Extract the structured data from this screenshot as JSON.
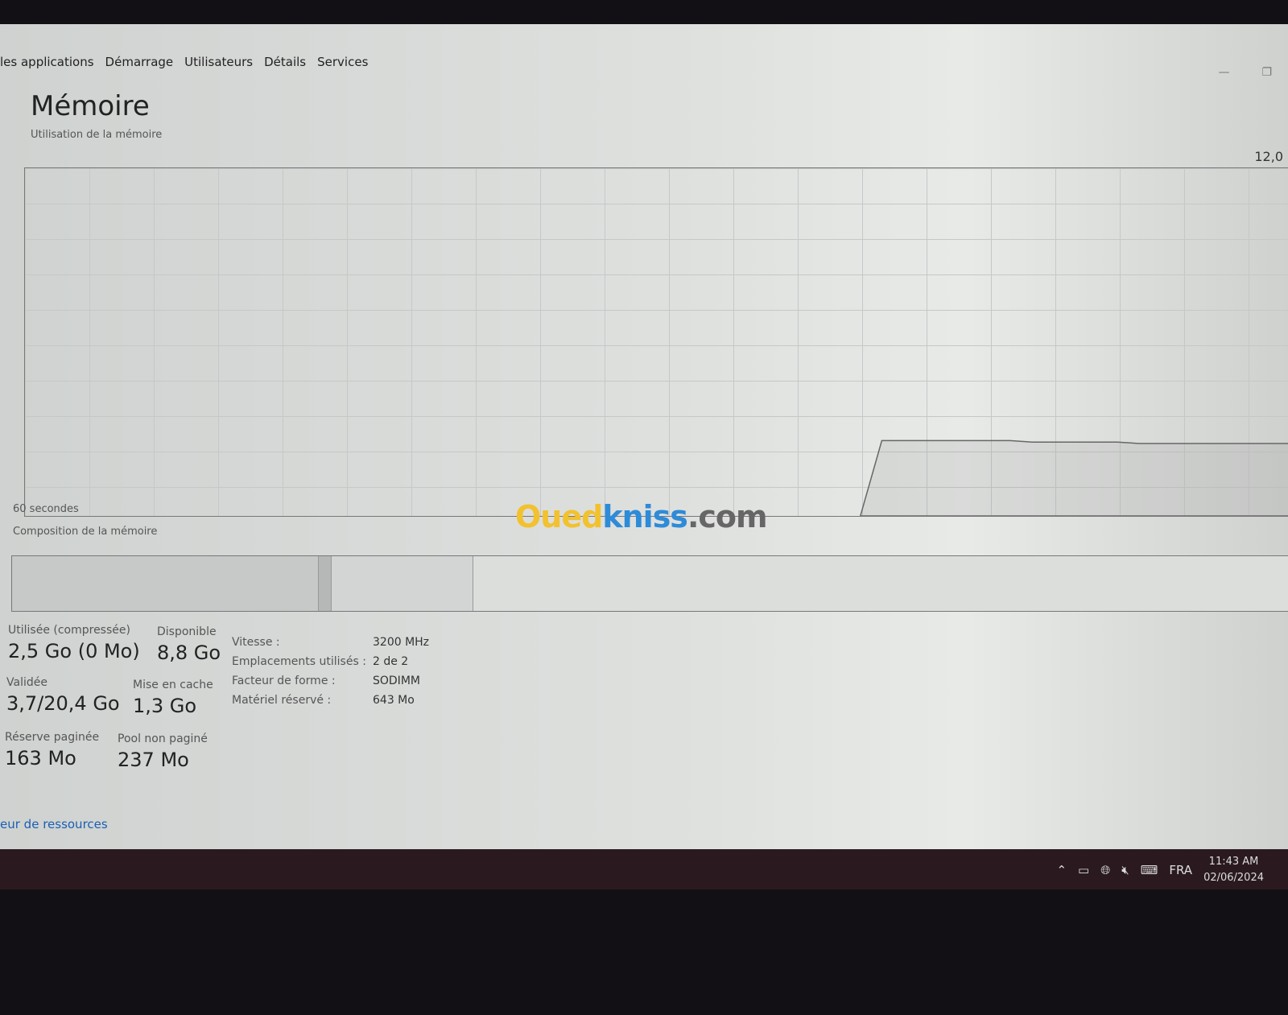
{
  "tabs": [
    "les applications",
    "Démarrage",
    "Utilisateurs",
    "Détails",
    "Services"
  ],
  "title": "Mémoire",
  "graph": {
    "label": "Utilisation de la mémoire",
    "max_label": "12,0",
    "time_label": "60 secondes",
    "max_go": 12.0,
    "usage_go": [
      0,
      0,
      0,
      0,
      0,
      0,
      0,
      0,
      0,
      0,
      0,
      0,
      0,
      0,
      0,
      0,
      0,
      0,
      0,
      0,
      0,
      0,
      0,
      0,
      0,
      0,
      0,
      0,
      0,
      0,
      0,
      0,
      0,
      0,
      0,
      0,
      0,
      0,
      0,
      0,
      2.6,
      2.6,
      2.6,
      2.6,
      2.6,
      2.6,
      2.6,
      2.55,
      2.55,
      2.55,
      2.55,
      2.55,
      2.5,
      2.5,
      2.5,
      2.5,
      2.5,
      2.5,
      2.5,
      2.5
    ]
  },
  "composition": {
    "label": "Composition de la mémoire",
    "segments_pct": [
      {
        "pct": 24,
        "color": "#c6c9c7"
      },
      {
        "pct": 1,
        "color": "#b5b8b6"
      },
      {
        "pct": 11,
        "color": "#d2d5d3"
      },
      {
        "pct": 64,
        "color": "#dcdedc"
      }
    ]
  },
  "stats": {
    "used": {
      "label": "Utilisée (compressée)",
      "value": "2,5 Go (0 Mo)"
    },
    "available": {
      "label": "Disponible",
      "value": "8,8 Go"
    },
    "committed": {
      "label": "Validée",
      "value": "3,7/20,4 Go"
    },
    "cached": {
      "label": "Mise en cache",
      "value": "1,3 Go"
    },
    "paged": {
      "label": "Réserve paginée",
      "value": "163 Mo"
    },
    "nonpaged": {
      "label": "Pool non paginé",
      "value": "237 Mo"
    }
  },
  "hardware": [
    {
      "k": "Vitesse :",
      "v": "3200 MHz"
    },
    {
      "k": "Emplacements utilisés :",
      "v": "2 de 2"
    },
    {
      "k": "Facteur de forme :",
      "v": "SODIMM"
    },
    {
      "k": "Matériel réservé :",
      "v": "643 Mo"
    }
  ],
  "link": "eur de ressources",
  "watermark": {
    "a": "Oued",
    "b": "kniss",
    ".com": ".com",
    "colors": {
      "a": "#f2c12e",
      "b": "#2e8bd8",
      "c": "#555"
    }
  },
  "taskbar": {
    "lang": "FRA",
    "time": "11:43 AM",
    "date": "02/06/2024"
  }
}
